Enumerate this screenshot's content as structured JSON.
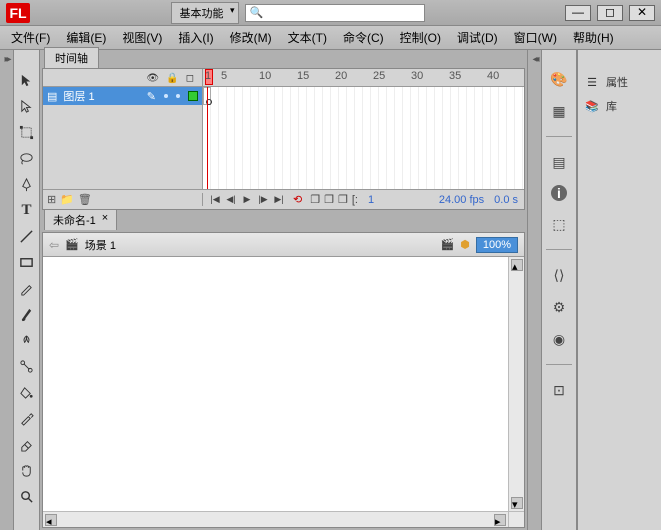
{
  "app": {
    "logo": "FL"
  },
  "titlebar": {
    "workspace": "基本功能"
  },
  "menus": [
    "文件(F)",
    "编辑(E)",
    "视图(V)",
    "插入(I)",
    "修改(M)",
    "文本(T)",
    "命令(C)",
    "控制(O)",
    "调试(D)",
    "窗口(W)",
    "帮助(H)"
  ],
  "timeline": {
    "tab": "时间轴",
    "ruler": [
      "1",
      "5",
      "10",
      "15",
      "20",
      "25",
      "30",
      "35",
      "40"
    ],
    "layer": "图层 1",
    "footer": {
      "frame": "1",
      "fps": "24.00 fps",
      "time": "0.0 s"
    }
  },
  "document": {
    "tab": "未命名-1",
    "scene": "场景 1",
    "zoom": "100%"
  },
  "right_panel": {
    "properties": "属性",
    "library": "库"
  }
}
